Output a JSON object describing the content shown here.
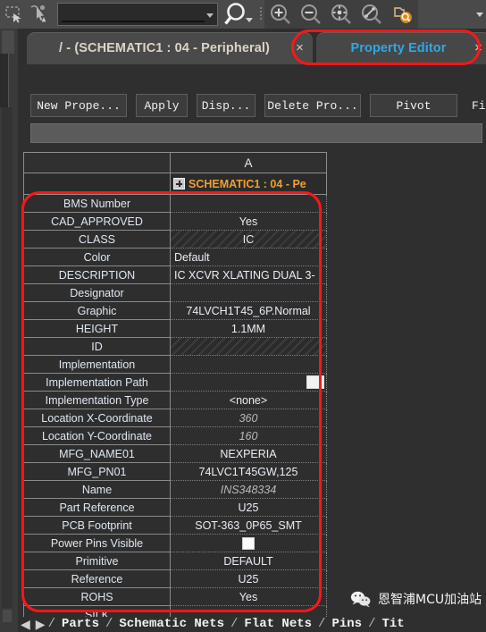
{
  "toolbar": {
    "search_value": "",
    "search_placeholder": "",
    "icons": [
      "select-rectangle-icon",
      "pointer-warning-icon",
      "magnifier-search-icon",
      "zoom-in-icon",
      "zoom-out-icon",
      "zoom-fit-icon",
      "zoom-area-icon",
      "zoom-find-icon"
    ]
  },
  "tabs": [
    {
      "label": "/ - (SCHEMATIC1 : 04 - Peripheral)",
      "close": "×",
      "active": false
    },
    {
      "label": "Property Editor",
      "close": "×",
      "active": true
    }
  ],
  "editor": {
    "buttons": [
      "New Prope...",
      "Apply",
      "Disp...",
      "Delete Pro...",
      "Pivot",
      "Filter"
    ],
    "filter_value": ""
  },
  "grid": {
    "column_header": "A",
    "object_title": "SCHEMATIC1 : 04 - Pe",
    "rows": [
      {
        "name": "BMS Number",
        "value": "",
        "style": "normal",
        "control": "none"
      },
      {
        "name": "CAD_APPROVED",
        "value": "Yes",
        "style": "normal",
        "control": "none"
      },
      {
        "name": "CLASS",
        "value": "IC",
        "style": "readonly",
        "control": "none"
      },
      {
        "name": "Color",
        "value": "Default",
        "style": "left",
        "control": "none"
      },
      {
        "name": "DESCRIPTION",
        "value": "IC XCVR XLATING DUAL 3-",
        "style": "left",
        "control": "none"
      },
      {
        "name": "Designator",
        "value": "",
        "style": "normal",
        "control": "none"
      },
      {
        "name": "Graphic",
        "value": "74LVCH1T45_6P.Normal",
        "style": "normal",
        "control": "none"
      },
      {
        "name": "HEIGHT",
        "value": "1.1MM",
        "style": "normal",
        "control": "none"
      },
      {
        "name": "ID",
        "value": "",
        "style": "readonly",
        "control": "none"
      },
      {
        "name": "Implementation",
        "value": "",
        "style": "normal",
        "control": "none"
      },
      {
        "name": "Implementation Path",
        "value": "",
        "style": "normal",
        "control": "browse"
      },
      {
        "name": "Implementation Type",
        "value": "<none>",
        "style": "normal",
        "control": "none"
      },
      {
        "name": "Location X-Coordinate",
        "value": "360",
        "style": "italic",
        "control": "none"
      },
      {
        "name": "Location Y-Coordinate",
        "value": "160",
        "style": "italic",
        "control": "none"
      },
      {
        "name": "MFG_NAME01",
        "value": "NEXPERIA",
        "style": "normal",
        "control": "none"
      },
      {
        "name": "MFG_PN01",
        "value": "74LVC1T45GW,125",
        "style": "normal",
        "control": "none"
      },
      {
        "name": "Name",
        "value": "INS348334",
        "style": "italic",
        "control": "none"
      },
      {
        "name": "Part Reference",
        "value": "U25",
        "style": "normal",
        "control": "none"
      },
      {
        "name": "PCB Footprint",
        "value": "SOT-363_0P65_SMT",
        "style": "normal",
        "control": "none"
      },
      {
        "name": "Power Pins Visible",
        "value": "",
        "style": "normal",
        "control": "checkbox"
      },
      {
        "name": "Primitive",
        "value": "DEFAULT",
        "style": "normal",
        "control": "none"
      },
      {
        "name": "Reference",
        "value": "U25",
        "style": "normal",
        "control": "none"
      },
      {
        "name": "ROHS",
        "value": "Yes",
        "style": "normal",
        "control": "none"
      },
      {
        "name": "SILK",
        "value": "",
        "style": "normal",
        "control": "none"
      }
    ]
  },
  "bottom_tabs": [
    "Parts",
    "Schematic Nets",
    "Flat Nets",
    "Pins",
    "Tit"
  ],
  "watermark": {
    "text": "恩智浦MCU加油站"
  },
  "colors": {
    "accent_tab": "#2ea8e6",
    "object_title": "#f0a030",
    "annotation": "#ff1616",
    "property_name": "#dfe8f2",
    "panel_bg": "#2f2f2f"
  }
}
